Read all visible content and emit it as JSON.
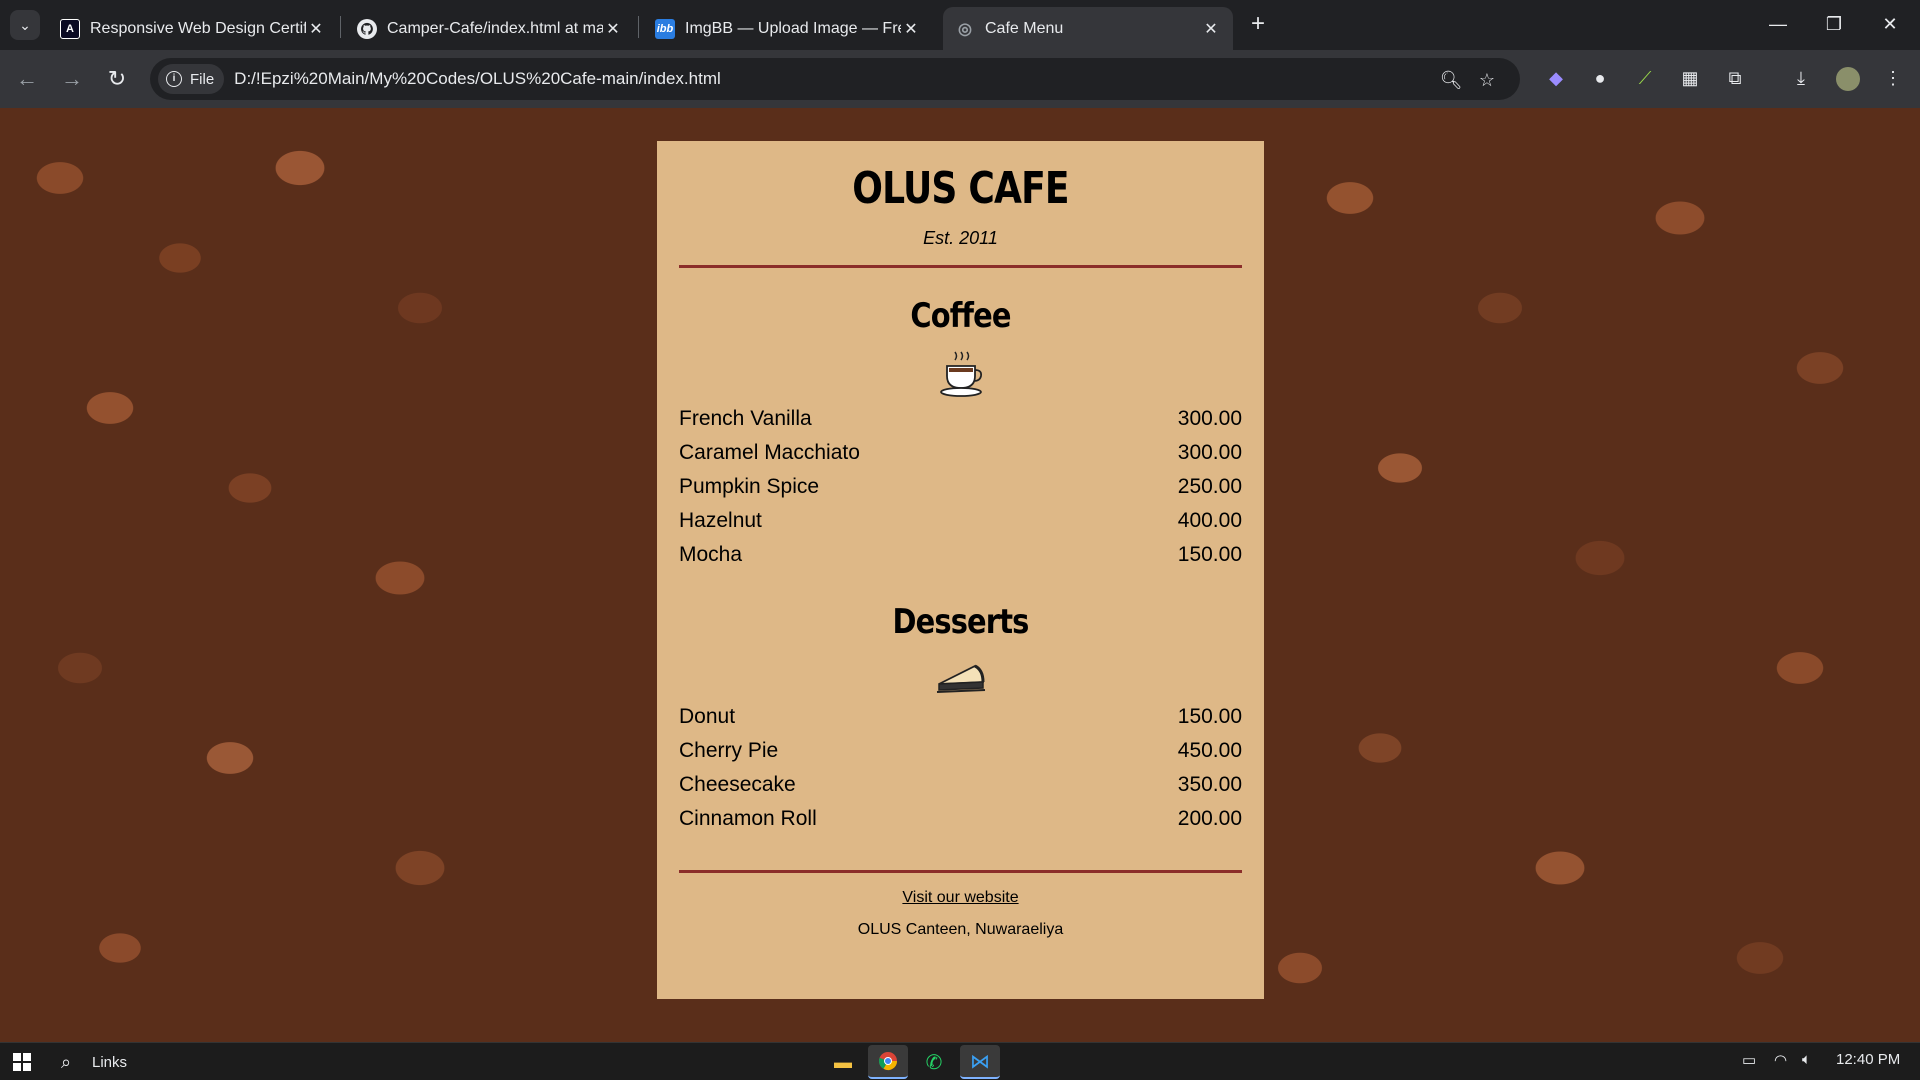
{
  "browser": {
    "tabs": [
      {
        "title": "Responsive Web Design Certific",
        "favicon": "A"
      },
      {
        "title": "Camper-Cafe/index.html at mai",
        "favicon": "github-icon"
      },
      {
        "title": "ImgBB — Upload Image — Free",
        "favicon": "ibb"
      },
      {
        "title": "Cafe Menu",
        "favicon": "page-icon"
      }
    ],
    "address": {
      "chip_label": "File",
      "url": "D:/!Epzi%20Main/My%20Codes/OLUS%20Cafe-main/index.html"
    }
  },
  "menu": {
    "cafe_name": "OLUS CAFE",
    "established": "Est. 2011",
    "sections": [
      {
        "title": "Coffee",
        "icon": "coffee-cup-icon",
        "items": [
          {
            "name": "French Vanilla",
            "price": "300.00"
          },
          {
            "name": "Caramel Macchiato",
            "price": "300.00"
          },
          {
            "name": "Pumpkin Spice",
            "price": "250.00"
          },
          {
            "name": "Hazelnut",
            "price": "400.00"
          },
          {
            "name": "Mocha",
            "price": "150.00"
          }
        ]
      },
      {
        "title": "Desserts",
        "icon": "pie-icon",
        "items": [
          {
            "name": "Donut",
            "price": "150.00"
          },
          {
            "name": "Cherry Pie",
            "price": "450.00"
          },
          {
            "name": "Cheesecake",
            "price": "350.00"
          },
          {
            "name": "Cinnamon Roll",
            "price": "200.00"
          }
        ]
      }
    ],
    "footer": {
      "link_text": "Visit our website",
      "address": "OLUS Canteen, Nuwaraeliya"
    },
    "colors": {
      "background": "#deb887",
      "divider": "#8b2e2a"
    }
  },
  "taskbar": {
    "links_label": "Links",
    "time": "12:40 PM"
  }
}
